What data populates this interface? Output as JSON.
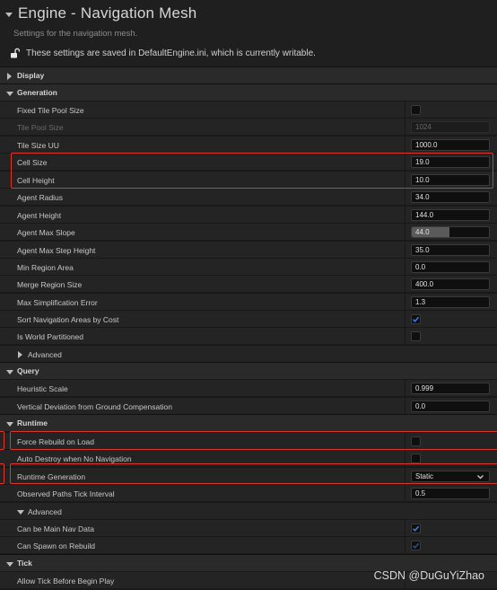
{
  "header": {
    "title": "Engine - Navigation Mesh",
    "subtitle": "Settings for the navigation mesh.",
    "save_notice": "These settings are saved in DefaultEngine.ini, which is currently writable."
  },
  "sections": {
    "display": "Display",
    "generation": "Generation",
    "query": "Query",
    "runtime": "Runtime",
    "tick": "Tick"
  },
  "generation": {
    "fixed_tile_pool_size": {
      "label": "Fixed Tile Pool Size",
      "checked": false
    },
    "tile_pool_size": {
      "label": "Tile Pool Size",
      "value": "1024"
    },
    "tile_size_uu": {
      "label": "Tile Size UU",
      "value": "1000.0"
    },
    "cell_size": {
      "label": "Cell Size",
      "value": "19.0"
    },
    "cell_height": {
      "label": "Cell Height",
      "value": "10.0"
    },
    "agent_radius": {
      "label": "Agent Radius",
      "value": "34.0"
    },
    "agent_height": {
      "label": "Agent Height",
      "value": "144.0"
    },
    "agent_max_slope": {
      "label": "Agent Max Slope",
      "value": "44.0",
      "fill": 0.49
    },
    "agent_max_step_height": {
      "label": "Agent Max Step Height",
      "value": "35.0"
    },
    "min_region_area": {
      "label": "Min Region Area",
      "value": "0.0"
    },
    "merge_region_size": {
      "label": "Merge Region Size",
      "value": "400.0"
    },
    "max_simplification_error": {
      "label": "Max Simplification Error",
      "value": "1.3"
    },
    "sort_navigation_areas": {
      "label": "Sort Navigation Areas by Cost",
      "checked": true
    },
    "is_world_partitioned": {
      "label": "Is World Partitioned",
      "checked": false
    },
    "advanced": "Advanced"
  },
  "query": {
    "heuristic_scale": {
      "label": "Heuristic Scale",
      "value": "0.999"
    },
    "vertical_deviation": {
      "label": "Vertical Deviation from Ground Compensation",
      "value": "0.0"
    }
  },
  "runtime": {
    "force_rebuild_on_load": {
      "label": "Force Rebuild on Load",
      "checked": false
    },
    "auto_destroy": {
      "label": "Auto Destroy when No Navigation",
      "checked": false
    },
    "runtime_generation": {
      "label": "Runtime Generation",
      "value": "Static"
    },
    "observed_paths_tick": {
      "label": "Observed Paths Tick Interval",
      "value": "0.5"
    },
    "advanced": "Advanced",
    "can_be_main_nav_data": {
      "label": "Can be Main Nav Data",
      "checked": true
    },
    "can_spawn_on_rebuild": {
      "label": "Can Spawn on Rebuild",
      "checked": true
    }
  },
  "tick": {
    "allow_tick": {
      "label": "Allow Tick Before Begin Play"
    }
  },
  "watermark": "CSDN @DuGuYiZhao",
  "colors": {
    "highlight": "#e0352b",
    "check": "#3d7bd6"
  }
}
